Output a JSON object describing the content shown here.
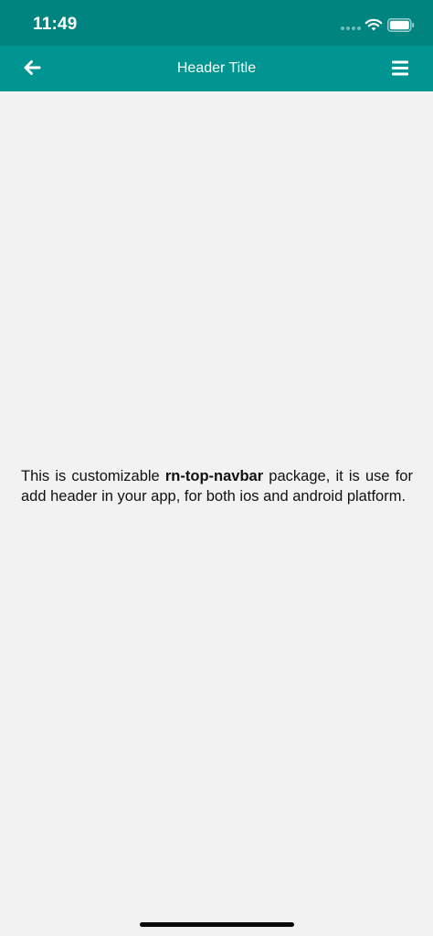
{
  "status_bar": {
    "time": "11:49"
  },
  "header": {
    "title": "Header Title",
    "back_icon": "arrow-left-icon",
    "menu_icon": "hamburger-menu-icon"
  },
  "content": {
    "text_before": "This is customizable ",
    "package_name": "rn-top-navbar",
    "text_after": " package, it is use for add header in your app, for both ios and android platform."
  },
  "colors": {
    "status_bar": "#00847f",
    "header": "#009590",
    "background": "#f2f2f2",
    "text": "#111111"
  }
}
